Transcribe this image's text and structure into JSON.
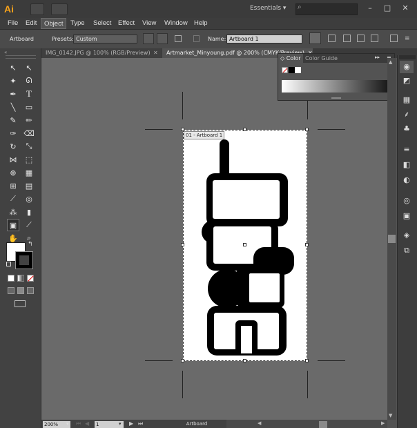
{
  "app": {
    "logo": "Ai"
  },
  "workspace": {
    "label": "Essentials ▾",
    "search_placeholder": ""
  },
  "window_controls": {
    "minimize": "–",
    "maximize": "□",
    "close": "✕"
  },
  "menu": {
    "items": [
      "File",
      "Edit",
      "Object",
      "Type",
      "Select",
      "Effect",
      "View",
      "Window",
      "Help"
    ],
    "active": "Object"
  },
  "control_bar": {
    "tool_label": "Artboard",
    "presets_label": "Presets:",
    "presets_value": "Custom",
    "name_label": "Name:",
    "name_value": "Artboard 1"
  },
  "tabs": [
    {
      "label": "IMG_0142.JPG @ 100% (RGB/Preview)",
      "close": "✕",
      "active": false
    },
    {
      "label": "Artmarket_Minyoung.pdf @ 200% (CMYK/Preview)",
      "close": "✕",
      "active": true
    }
  ],
  "color_panel": {
    "tab_color": "◇ Color",
    "tab_guide": "Color Guide",
    "menu_glyph": "▸▸",
    "menu_icon": "≡"
  },
  "artboard": {
    "label": "01 - Artboard 1"
  },
  "status": {
    "zoom": "200%",
    "page": "1",
    "tool": "Artboard"
  },
  "colors": {
    "accent": "#f7a21b",
    "canvas": "#6a6a6a",
    "chrome": "#535353"
  }
}
